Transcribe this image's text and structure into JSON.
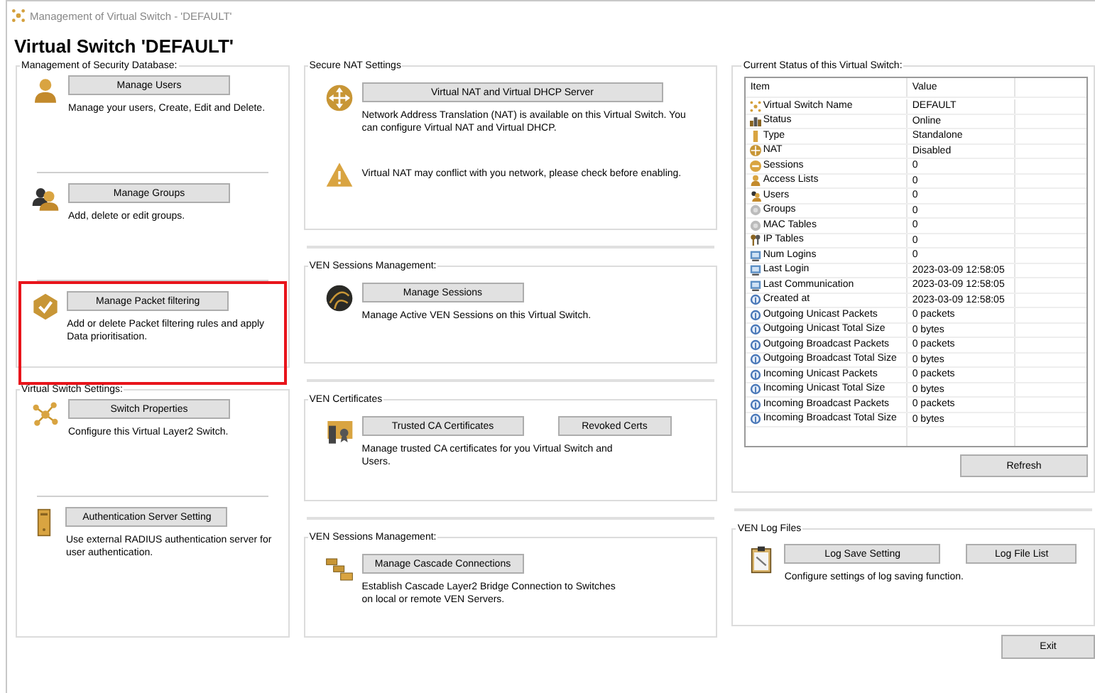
{
  "window": {
    "title": "Management of Virtual Switch - 'DEFAULT'"
  },
  "heading": "Virtual Switch 'DEFAULT'",
  "left": [
    {
      "title": "Management of Security Database:",
      "items": [
        {
          "buttons": [
            "Manage Users"
          ],
          "description": "Manage your users, Create, Edit and Delete.",
          "highlighted": false
        },
        {
          "buttons": [
            "Manage Groups"
          ],
          "description": "Add, delete or edit groups.",
          "highlighted": false
        },
        {
          "buttons": [
            "Manage Packet filtering"
          ],
          "description": "Add or delete Packet filtering rules and apply Data prioritisation.",
          "highlighted": true
        }
      ]
    },
    {
      "title": "Virtual Switch Settings:",
      "items": [
        {
          "buttons": [
            "Switch Properties"
          ],
          "description": "Configure this Virtual Layer2 Switch.",
          "highlighted": false
        },
        {
          "buttons": [
            "Authentication Server Setting"
          ],
          "description": "Use external RADIUS authentication server for user authentication.",
          "highlighted": false
        }
      ]
    }
  ],
  "middle": [
    {
      "title": "Secure NAT Settings",
      "items": [
        {
          "buttons": [
            "Virtual NAT and Virtual DHCP Server"
          ],
          "description": "Network Address Translation (NAT) is available on this Virtual Switch. You can configure Virtual NAT and Virtual DHCP."
        },
        {
          "description": "Virtual NAT may conflict with you network, please check before enabling."
        }
      ]
    },
    {
      "title": "VEN Sessions Management:",
      "items": [
        {
          "buttons": [
            "Manage Sessions"
          ],
          "description": "Manage Active VEN Sessions on this Virtual Switch."
        }
      ]
    },
    {
      "title": "VEN Certificates",
      "items": [
        {
          "buttons": [
            "Trusted CA Certificates",
            "Revoked Certs"
          ],
          "description": "Manage trusted CA certificates for you Virtual Switch and Users."
        }
      ]
    },
    {
      "title": "VEN Sessions Management:",
      "items": [
        {
          "buttons": [
            "Manage Cascade Connections"
          ],
          "description": "Establish Cascade Layer2 Bridge Connection to Switches on local or remote VEN Servers."
        }
      ]
    }
  ],
  "status": {
    "title": "Current Status of this Virtual Switch:",
    "columns": [
      "Item",
      "Value"
    ],
    "rows": [
      [
        "Virtual Switch Name",
        "DEFAULT"
      ],
      [
        "Status",
        "Online"
      ],
      [
        "Type",
        "Standalone"
      ],
      [
        "NAT",
        "Disabled"
      ],
      [
        "Sessions",
        "0"
      ],
      [
        "Access Lists",
        "0"
      ],
      [
        "Users",
        "0"
      ],
      [
        "Groups",
        "0"
      ],
      [
        "MAC Tables",
        "0"
      ],
      [
        "IP Tables",
        "0"
      ],
      [
        "Num Logins",
        "0"
      ],
      [
        "Last Login",
        "2023-03-09 12:58:05"
      ],
      [
        "Last Communication",
        "2023-03-09 12:58:05"
      ],
      [
        "Created at",
        "2023-03-09 12:58:05"
      ],
      [
        "Outgoing Unicast Packets",
        "0 packets"
      ],
      [
        "Outgoing Unicast Total Size",
        "0 bytes"
      ],
      [
        "Outgoing Broadcast Packets",
        "0 packets"
      ],
      [
        "Outgoing Broadcast Total Size",
        "0 bytes"
      ],
      [
        "Incoming Unicast Packets",
        "0 packets"
      ],
      [
        "Incoming Unicast Total Size",
        "0 bytes"
      ],
      [
        "Incoming Broadcast Packets",
        "0 packets"
      ],
      [
        "Incoming Broadcast Total Size",
        "0 bytes"
      ]
    ],
    "refresh_button": "Refresh"
  },
  "log_files": {
    "title": "VEN Log Files",
    "buttons": [
      "Log Save Setting",
      "Log File List"
    ],
    "description": "Configure settings of log saving function."
  },
  "exit_button": "Exit"
}
